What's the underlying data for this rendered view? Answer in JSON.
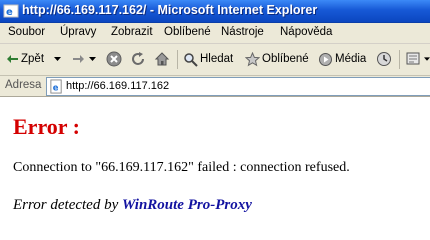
{
  "window": {
    "title": "http://66.169.117.162/ - Microsoft Internet Explorer"
  },
  "menu": {
    "items": [
      {
        "label": "Soubor"
      },
      {
        "label": "Úpravy"
      },
      {
        "label": "Zobrazit"
      },
      {
        "label": "Oblíbené"
      },
      {
        "label": "Nástroje"
      },
      {
        "label": "Nápověda"
      }
    ]
  },
  "toolbar": {
    "back_label": "Zpět",
    "search_label": "Hledat",
    "favorites_label": "Oblíbené",
    "media_label": "Média"
  },
  "address": {
    "label": "Adresa",
    "url": "http://66.169.117.162"
  },
  "page": {
    "error_title": "Error :",
    "message": "Connection to \"66.169.117.162\" failed : connection refused.",
    "footer_prefix": "Error detected by",
    "footer_brand": "WinRoute Pro-Proxy"
  }
}
